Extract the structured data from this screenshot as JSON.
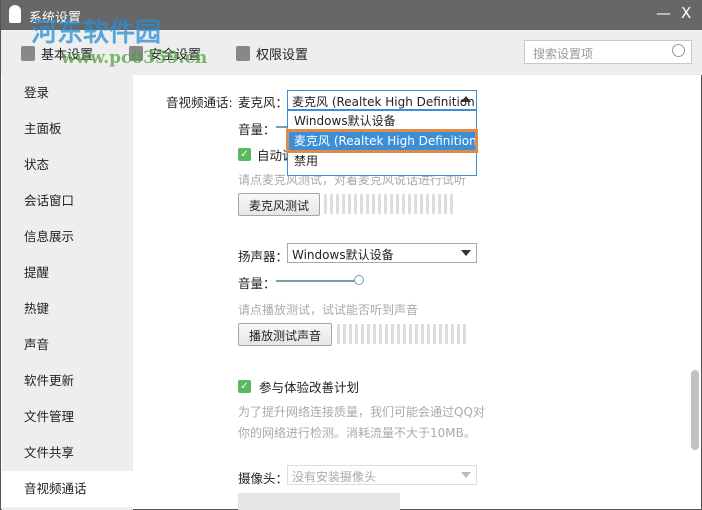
{
  "window": {
    "title": "系统设置",
    "minimize": "—",
    "close": "X"
  },
  "watermark": {
    "name": "河东软件园",
    "url": "www.pc0359.cn"
  },
  "tabs": [
    {
      "label": "基本设置"
    },
    {
      "label": "安全设置"
    },
    {
      "label": "权限设置"
    }
  ],
  "search": {
    "placeholder": "搜索设置项"
  },
  "sidebar": {
    "items": [
      "登录",
      "主面板",
      "状态",
      "会话窗口",
      "信息展示",
      "提醒",
      "热键",
      "声音",
      "软件更新",
      "文件管理",
      "文件共享",
      "音视频通话"
    ],
    "active": "音视频通话"
  },
  "av": {
    "section_label": "音视频通话:",
    "mic_label": "麦克风：",
    "mic_value": "麦克风 (Realtek High Definition ...",
    "mic_options": [
      "Windows默认设备",
      "麦克风 (Realtek High Definition Audio",
      "禁用"
    ],
    "volume_label": "音量：",
    "auto_label": "自动调节麦克风音量",
    "mic_hint": "请点麦克风测试，对着麦克风说话进行试听",
    "mic_test": "麦克风测试",
    "speaker_label": "扬声器：",
    "speaker_value": "Windows默认设备",
    "speaker_volume": 0.8,
    "speaker_hint": "请点播放测试，试试能否听到声音",
    "play_test": "播放测试声音",
    "improve_label": "参与体验改善计划",
    "improve_desc1": "为了提升网络连接质量，我们可能会通过QQ对",
    "improve_desc2": "你的网络进行检测。消耗流量不大于10MB。",
    "camera_label": "摄像头：",
    "camera_value": "没有安装摄像头"
  }
}
